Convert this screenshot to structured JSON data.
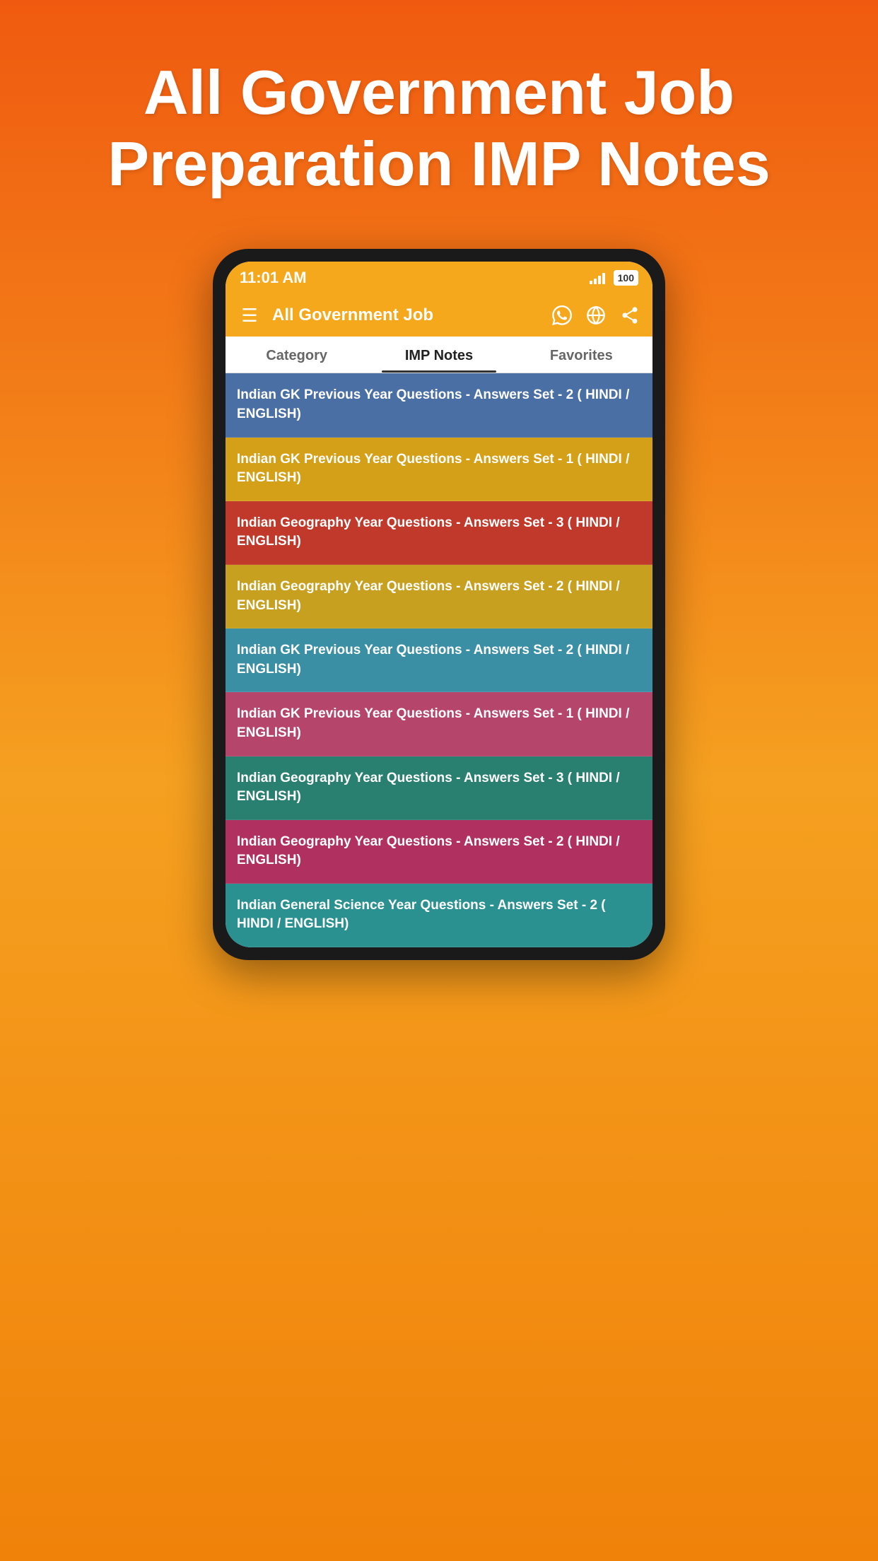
{
  "background": {
    "gradient_start": "#f05a10",
    "gradient_end": "#f5a020"
  },
  "page_title": "All Government Job Preparation IMP Notes",
  "status_bar": {
    "time": "11:01 AM",
    "battery": "100"
  },
  "app_bar": {
    "title": "All Government Job",
    "hamburger_label": "☰",
    "whatsapp_icon": "whatsapp",
    "globe_icon": "globe",
    "share_icon": "share"
  },
  "tabs": [
    {
      "label": "Category",
      "active": false
    },
    {
      "label": "IMP Notes",
      "active": true
    },
    {
      "label": "Favorites",
      "active": false
    }
  ],
  "list_items": [
    {
      "text": "Indian GK Previous Year Questions - Answers Set - 2 ( HINDI / ENGLISH)",
      "color_class": "item-blue-dark"
    },
    {
      "text": "Indian GK Previous Year Questions - Answers Set - 1 ( HINDI / ENGLISH)",
      "color_class": "item-yellow-dark"
    },
    {
      "text": "Indian Geography Year Questions - Answers Set - 3 ( HINDI / ENGLISH)",
      "color_class": "item-red"
    },
    {
      "text": "Indian Geography Year Questions - Answers Set - 2 ( HINDI / ENGLISH)",
      "color_class": "item-yellow"
    },
    {
      "text": "Indian GK Previous Year Questions - Answers Set - 2 ( HINDI / ENGLISH)",
      "color_class": "item-teal"
    },
    {
      "text": "Indian GK Previous Year Questions - Answers Set - 1 ( HINDI / ENGLISH)",
      "color_class": "item-pink"
    },
    {
      "text": "Indian Geography Year Questions - Answers Set - 3 ( HINDI / ENGLISH)",
      "color_class": "item-teal2"
    },
    {
      "text": "Indian Geography Year Questions - Answers Set - 2 ( HINDI / ENGLISH)",
      "color_class": "item-pink2"
    },
    {
      "text": "Indian General Science Year Questions - Answers Set - 2 ( HINDI / ENGLISH)",
      "color_class": "item-teal3"
    }
  ]
}
